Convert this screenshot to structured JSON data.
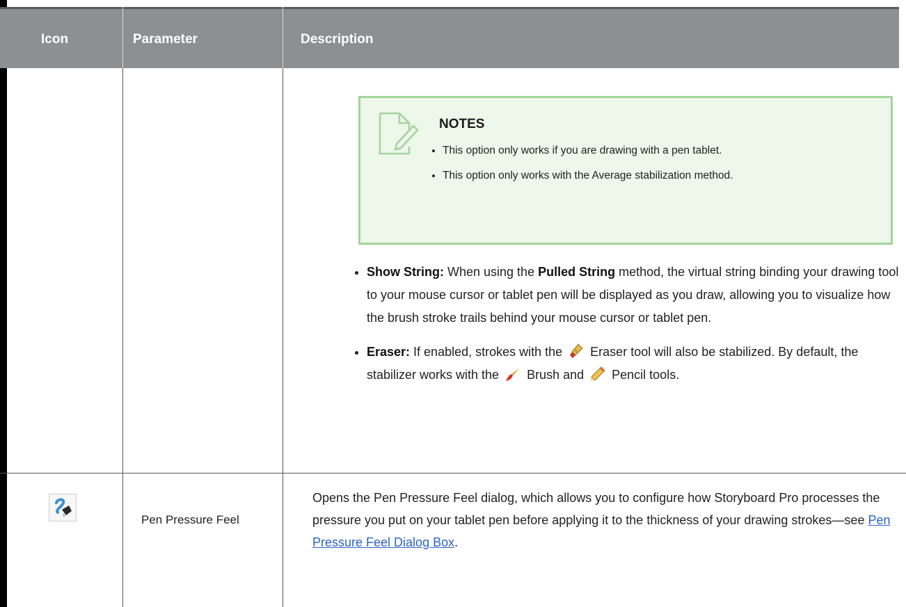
{
  "header": {
    "icon": "Icon",
    "parameter": "Parameter",
    "description": "Description"
  },
  "note": {
    "icon": "note-pencil-icon",
    "title": "NOTES",
    "items": [
      "This option only works if you are drawing with a pen tablet.",
      "This option only works with the Average stabilization method."
    ]
  },
  "bullets": {
    "show_string": {
      "label": "Show String:",
      "text1": " When using the ",
      "bold": "Pulled String",
      "text2": " method, the virtual string binding your drawing tool to your mouse cursor or tablet pen will be displayed as you draw, allowing you to visualize how the brush stroke trails behind your mouse cursor or tablet pen."
    },
    "eraser": {
      "label": "Eraser:",
      "text1": " If enabled, strokes with the ",
      "eraser_icon": "eraser-icon",
      "text2": " Eraser tool will also be stabilized. By default, the stabilizer works with the ",
      "brush_icon": "brush-icon",
      "text3": " Brush and ",
      "pencil_icon": "pencil-icon",
      "text4": " Pencil tools."
    }
  },
  "row2": {
    "icon": "pen-pressure-icon",
    "parameter": "Pen Pressure Feel",
    "description": "Opens the Pen Pressure Feel dialog, which allows you to configure how Storyboard Pro processes the pressure you put on your tablet pen before applying it to the thickness of your drawing strokes—see ",
    "link": "Pen Pressure Feel Dialog Box",
    "end": "."
  },
  "colors": {
    "header_bg": "#8e8f91",
    "note_bg": "#edf7ea",
    "note_border": "#a3d49a",
    "link": "#2b63c8"
  }
}
